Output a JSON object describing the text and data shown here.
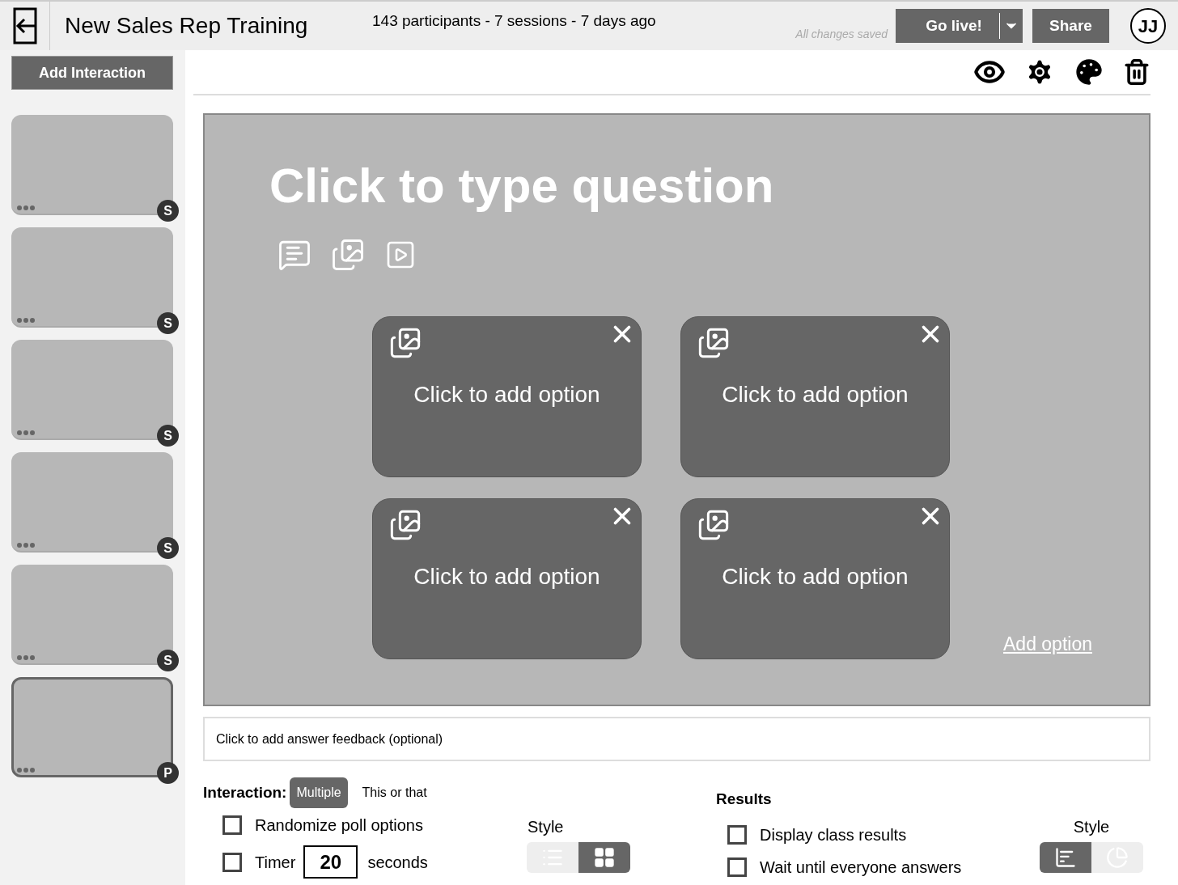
{
  "header": {
    "title": "New Sales Rep Training",
    "stats": "143 participants - 7 sessions - 7 days ago",
    "save_status": "All changes saved",
    "go_live": "Go live!",
    "share": "Share",
    "avatar": "JJ"
  },
  "sidebar": {
    "add_button": "Add Interaction",
    "slides": [
      {
        "badge": "S",
        "selected": false
      },
      {
        "badge": "S",
        "selected": false
      },
      {
        "badge": "S",
        "selected": false
      },
      {
        "badge": "S",
        "selected": false
      },
      {
        "badge": "S",
        "selected": false
      },
      {
        "badge": "P",
        "selected": true
      }
    ]
  },
  "slide": {
    "question": "Click to type question",
    "options": [
      "Click to add option",
      "Click to add option",
      "Click to add option",
      "Click to add option"
    ],
    "add_option": "Add option"
  },
  "feedback": {
    "placeholder": "Click to add answer feedback (optional)"
  },
  "interaction": {
    "label": "Interaction:",
    "types": [
      {
        "label": "Multiple",
        "selected": true
      },
      {
        "label": "This or that",
        "selected": false
      }
    ],
    "settings": [
      {
        "label": "Randomize poll options",
        "checked": false,
        "kind": "checkbox"
      },
      {
        "label": "Timer",
        "checked": false,
        "kind": "timer",
        "value": "20",
        "suffix": "seconds"
      }
    ],
    "style_label": "Style",
    "styles": [
      {
        "kind": "list",
        "selected": false
      },
      {
        "kind": "grid",
        "selected": true
      }
    ]
  },
  "results": {
    "label": "Results",
    "settings": [
      {
        "label": "Display class results",
        "checked": false
      },
      {
        "label": "Wait until everyone answers",
        "checked": false
      }
    ],
    "style_label": "Style",
    "styles": [
      {
        "kind": "bar",
        "selected": true
      },
      {
        "kind": "pie",
        "selected": false
      }
    ]
  }
}
